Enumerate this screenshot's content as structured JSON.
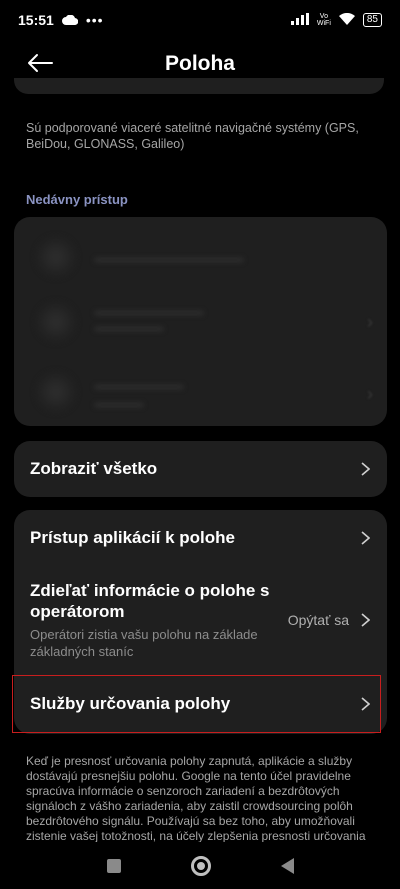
{
  "status_bar": {
    "time": "15:51",
    "battery": "85",
    "vowifi_line1": "Vo",
    "vowifi_line2": "WiFi"
  },
  "header": {
    "title": "Poloha"
  },
  "gnss_description": "Sú podporované viaceré satelitné navigačné systémy (GPS, BeiDou, GLONASS, Galileo)",
  "recent_access": {
    "title": "Nedávny prístup"
  },
  "show_all": {
    "label": "Zobraziť všetko"
  },
  "settings": {
    "app_access": {
      "label": "Prístup aplikácií k polohe"
    },
    "share_with_operator": {
      "label": "Zdieľať informácie o polohe s operátorom",
      "subtitle": "Operátori zistia vašu polohu na základe základných staníc",
      "value": "Opýtať sa"
    },
    "location_services": {
      "label": "Služby určovania polohy"
    }
  },
  "footer_text": "Keď je presnosť určovania polohy zapnutá, aplikácie a služby dostávajú presnejšiu polohu. Google na tento účel pravidelne spracúva informácie o senzoroch zariadení a bezdrôtových signáloch z vášho zariadenia, aby zaistil crowdsourcing polôh bezdrôtového signálu. Používajú sa bez toho, aby umožňovali zistenie vašej totožnosti, na účely zlepšenia presnosti určovania",
  "colors": {
    "background": "#000000",
    "card": "#1f1f1f",
    "accent": "#8a93c2",
    "highlight": "#c81e1e"
  }
}
